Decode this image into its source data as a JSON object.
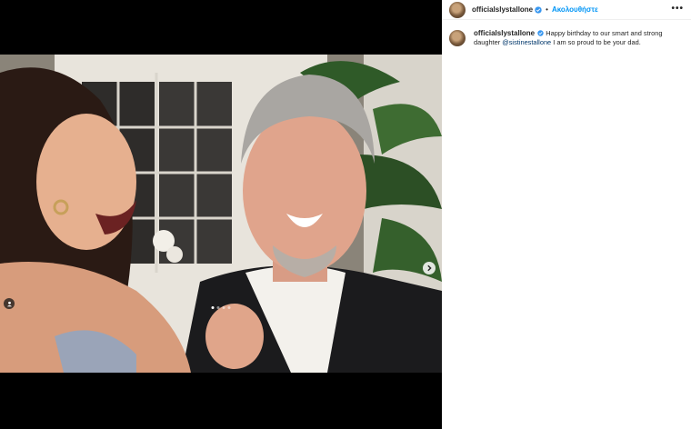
{
  "post": {
    "username": "officialslystallone",
    "follow_label": "Ακολουθήστε",
    "separator": "•",
    "more_label": "•••",
    "caption": {
      "username": "officialslystallone",
      "text_before": "Happy birthday to our smart and strong daughter ",
      "mention": "@sistinestallone",
      "text_after": " I am so proud to be your dad."
    },
    "carousel": {
      "slide_count": 4,
      "current_slide": 1
    }
  },
  "colors": {
    "accent": "#0095f6",
    "verified": "#3897f0",
    "mention": "#00376b",
    "text": "#262626"
  },
  "icons": [
    "verified-badge-icon",
    "more-options-icon",
    "chevron-right-icon",
    "user-tag-icon"
  ]
}
